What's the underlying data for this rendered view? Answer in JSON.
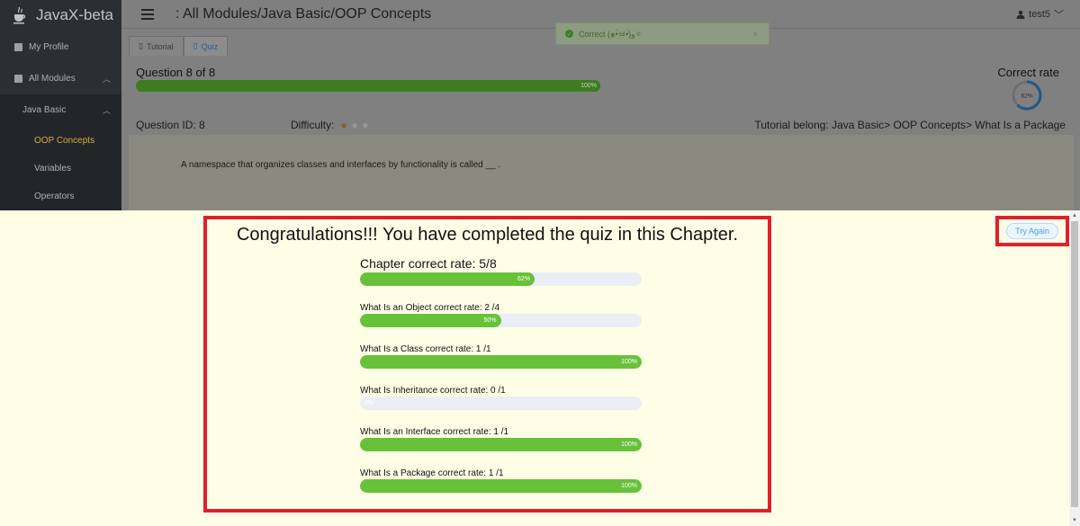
{
  "app": {
    "title": "JavaX-beta"
  },
  "sidebar": {
    "items": [
      {
        "label": "My Profile"
      },
      {
        "label": "All Modules"
      },
      {
        "label": "Java Basic"
      },
      {
        "label": "OOP Concepts"
      },
      {
        "label": "Variables"
      },
      {
        "label": "Operators"
      }
    ]
  },
  "header": {
    "breadcrumb": ": All Modules/Java Basic/OOP Concepts",
    "user": "test5"
  },
  "tabs": [
    {
      "label": "Tutorial"
    },
    {
      "label": "Quiz"
    }
  ],
  "toast": {
    "message": "Correct (๑•̀ㅂ•́)و✧",
    "check": "✓",
    "close": "×"
  },
  "quiz": {
    "question_counter": "Question 8 of 8",
    "progress_percent": 100,
    "progress_label": "100%",
    "correct_rate_label": "Correct rate",
    "correct_rate_percent": 62,
    "correct_rate_text": "62%",
    "question_id": "Question ID: 8",
    "difficulty_label": "Difficulty:",
    "difficulty_stars": 1,
    "difficulty_max": 3,
    "tutorial_belong": "Tutorial belong:  Java Basic> OOP Concepts> What Is a Package",
    "question_text": "A namespace that organizes classes and interfaces by functionality is called __ ."
  },
  "results": {
    "congrats": "Congratulations!!!  You have completed the quiz in this Chapter.",
    "chapter_label": "Chapter correct rate: 5/8",
    "chapter_percent": 62,
    "chapter_percent_text": "62%",
    "items": [
      {
        "label": "What Is an Object correct rate:  2 /4",
        "percent": 50,
        "percent_text": "50%"
      },
      {
        "label": "What Is a Class correct rate:  1 /1",
        "percent": 100,
        "percent_text": "100%"
      },
      {
        "label": "What Is Inheritance correct rate:  0 /1",
        "percent": 0,
        "percent_text": "0%"
      },
      {
        "label": "What Is an Interface correct rate:  1 /1",
        "percent": 100,
        "percent_text": "100%"
      },
      {
        "label": "What Is a Package correct rate:  1 /1",
        "percent": 100,
        "percent_text": "100%"
      }
    ]
  },
  "try_again": {
    "label": "Try Again"
  },
  "colors": {
    "success": "#67c23a",
    "track": "#ebeef5",
    "highlight": "#e1202a",
    "star": "#e6a23c",
    "accent": "#409eff"
  }
}
